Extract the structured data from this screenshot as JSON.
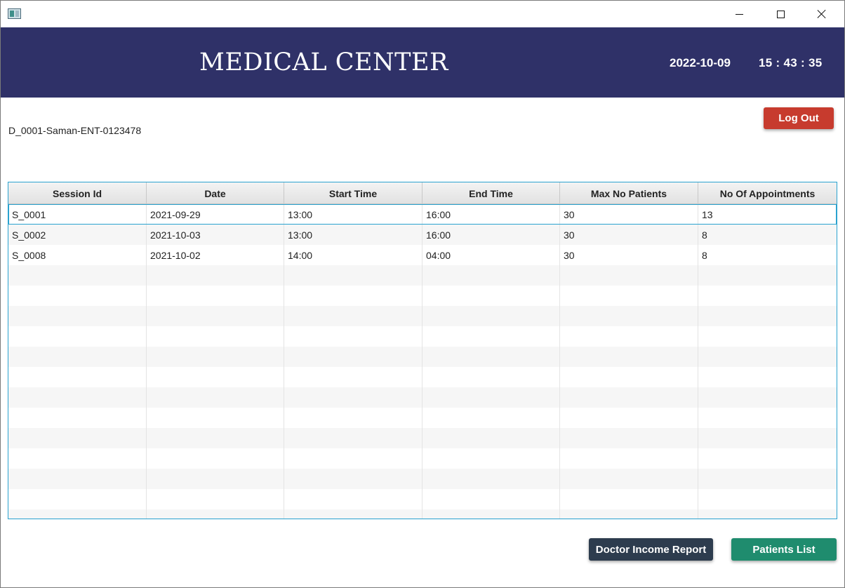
{
  "window": {
    "icon": "app-window-icon",
    "controls": [
      "minimize-icon",
      "maximize-icon",
      "close-icon"
    ]
  },
  "header": {
    "title": "MEDICAL CENTER",
    "date": "2022-10-09",
    "time": "15 : 43 : 35",
    "background_color": "#2f3168"
  },
  "doctor": {
    "info": "D_0001-Saman-ENT-0123478"
  },
  "actions": {
    "logout_label": "Log Out",
    "logout_color": "#c73b2e",
    "income_report_label": "Doctor Income Report",
    "income_report_color": "#2d3c4e",
    "patients_list_label": "Patients List",
    "patients_list_color": "#1f8c6e"
  },
  "sessions_table": {
    "columns": [
      "Session Id",
      "Date",
      "Start Time",
      "End Time",
      "Max No Patients",
      "No Of Appointments"
    ],
    "rows": [
      [
        "S_0001",
        "2021-09-29",
        "13:00",
        "16:00",
        "30",
        "13"
      ],
      [
        "S_0002",
        "2021-10-03",
        "13:00",
        "16:00",
        "30",
        "8"
      ],
      [
        "S_0008",
        "2021-10-02",
        "14:00",
        "04:00",
        "30",
        "8"
      ]
    ],
    "selected_row": 0,
    "empty_rows_visible": 13
  }
}
